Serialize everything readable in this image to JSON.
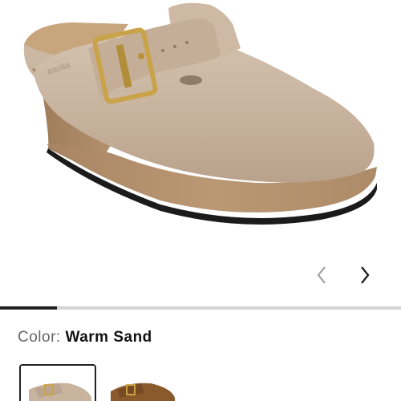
{
  "gallery": {
    "product_image": {
      "brand_emboss": "aaolia"
    },
    "prev_arrow": "‹",
    "next_arrow": "›",
    "progress": {
      "current": 1,
      "total": 7
    }
  },
  "color": {
    "label": "Color:",
    "value": "Warm Sand"
  },
  "swatches": [
    {
      "name": "Warm Sand",
      "selected": true
    },
    {
      "name": "Brown",
      "selected": false
    }
  ],
  "colors": {
    "suede": "#c9b5a0",
    "cork": "#b89470",
    "buckle": "#c9a34a",
    "accent": "#222222"
  }
}
